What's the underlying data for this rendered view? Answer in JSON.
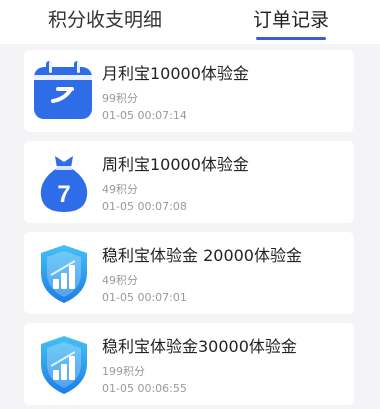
{
  "tabs": [
    {
      "label": "积分收支明细",
      "active": false
    },
    {
      "label": "订单记录",
      "active": true
    }
  ],
  "accent_color": "#3b5bdb",
  "orders": [
    {
      "icon": "calendar-icon",
      "title": "月利宝10000体验金",
      "points": "99积分",
      "time": "01-05 00:07:14"
    },
    {
      "icon": "money-bag-icon",
      "title": "周利宝10000体验金",
      "points": "49积分",
      "time": "01-05 00:07:08"
    },
    {
      "icon": "shield-chart-icon",
      "title": "稳利宝体验金 20000体验金",
      "points": "49积分",
      "time": "01-05 00:07:01"
    },
    {
      "icon": "shield-chart-icon",
      "title": "稳利宝体验金30000体验金",
      "points": "199积分",
      "time": "01-05 00:06:55"
    }
  ],
  "icon_glyphs": {
    "bag_number": "7"
  }
}
